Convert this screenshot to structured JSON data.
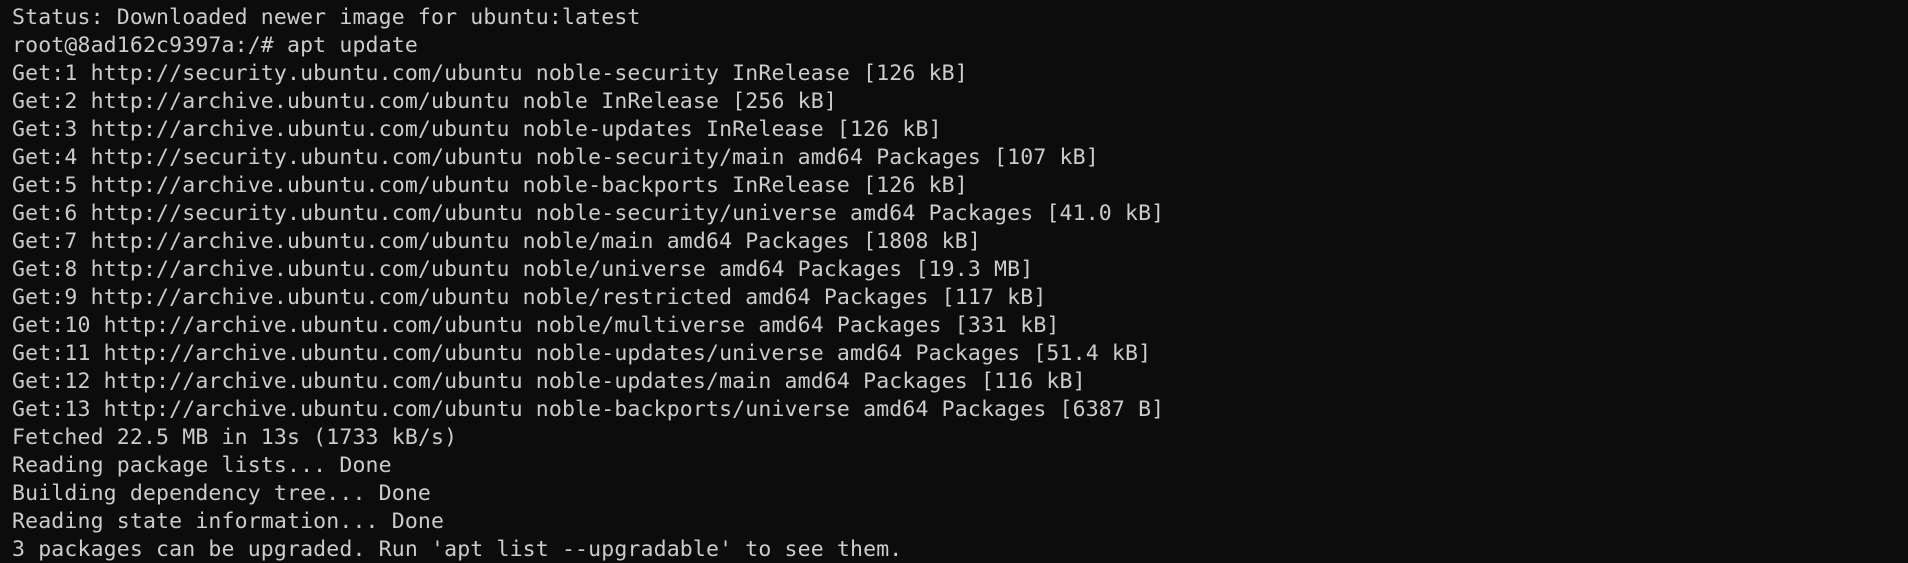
{
  "terminal": {
    "lines": [
      "Status: Downloaded newer image for ubuntu:latest",
      "root@8ad162c9397a:/# apt update",
      "Get:1 http://security.ubuntu.com/ubuntu noble-security InRelease [126 kB]",
      "Get:2 http://archive.ubuntu.com/ubuntu noble InRelease [256 kB]",
      "Get:3 http://archive.ubuntu.com/ubuntu noble-updates InRelease [126 kB]",
      "Get:4 http://security.ubuntu.com/ubuntu noble-security/main amd64 Packages [107 kB]",
      "Get:5 http://archive.ubuntu.com/ubuntu noble-backports InRelease [126 kB]",
      "Get:6 http://security.ubuntu.com/ubuntu noble-security/universe amd64 Packages [41.0 kB]",
      "Get:7 http://archive.ubuntu.com/ubuntu noble/main amd64 Packages [1808 kB]",
      "Get:8 http://archive.ubuntu.com/ubuntu noble/universe amd64 Packages [19.3 MB]",
      "Get:9 http://archive.ubuntu.com/ubuntu noble/restricted amd64 Packages [117 kB]",
      "Get:10 http://archive.ubuntu.com/ubuntu noble/multiverse amd64 Packages [331 kB]",
      "Get:11 http://archive.ubuntu.com/ubuntu noble-updates/universe amd64 Packages [51.4 kB]",
      "Get:12 http://archive.ubuntu.com/ubuntu noble-updates/main amd64 Packages [116 kB]",
      "Get:13 http://archive.ubuntu.com/ubuntu noble-backports/universe amd64 Packages [6387 B]",
      "Fetched 22.5 MB in 13s (1733 kB/s)",
      "Reading package lists... Done",
      "Building dependency tree... Done",
      "Reading state information... Done",
      "3 packages can be upgraded. Run 'apt list --upgradable' to see them."
    ]
  },
  "colors": {
    "background": "#0c0c0c",
    "text": "#cccccc"
  }
}
